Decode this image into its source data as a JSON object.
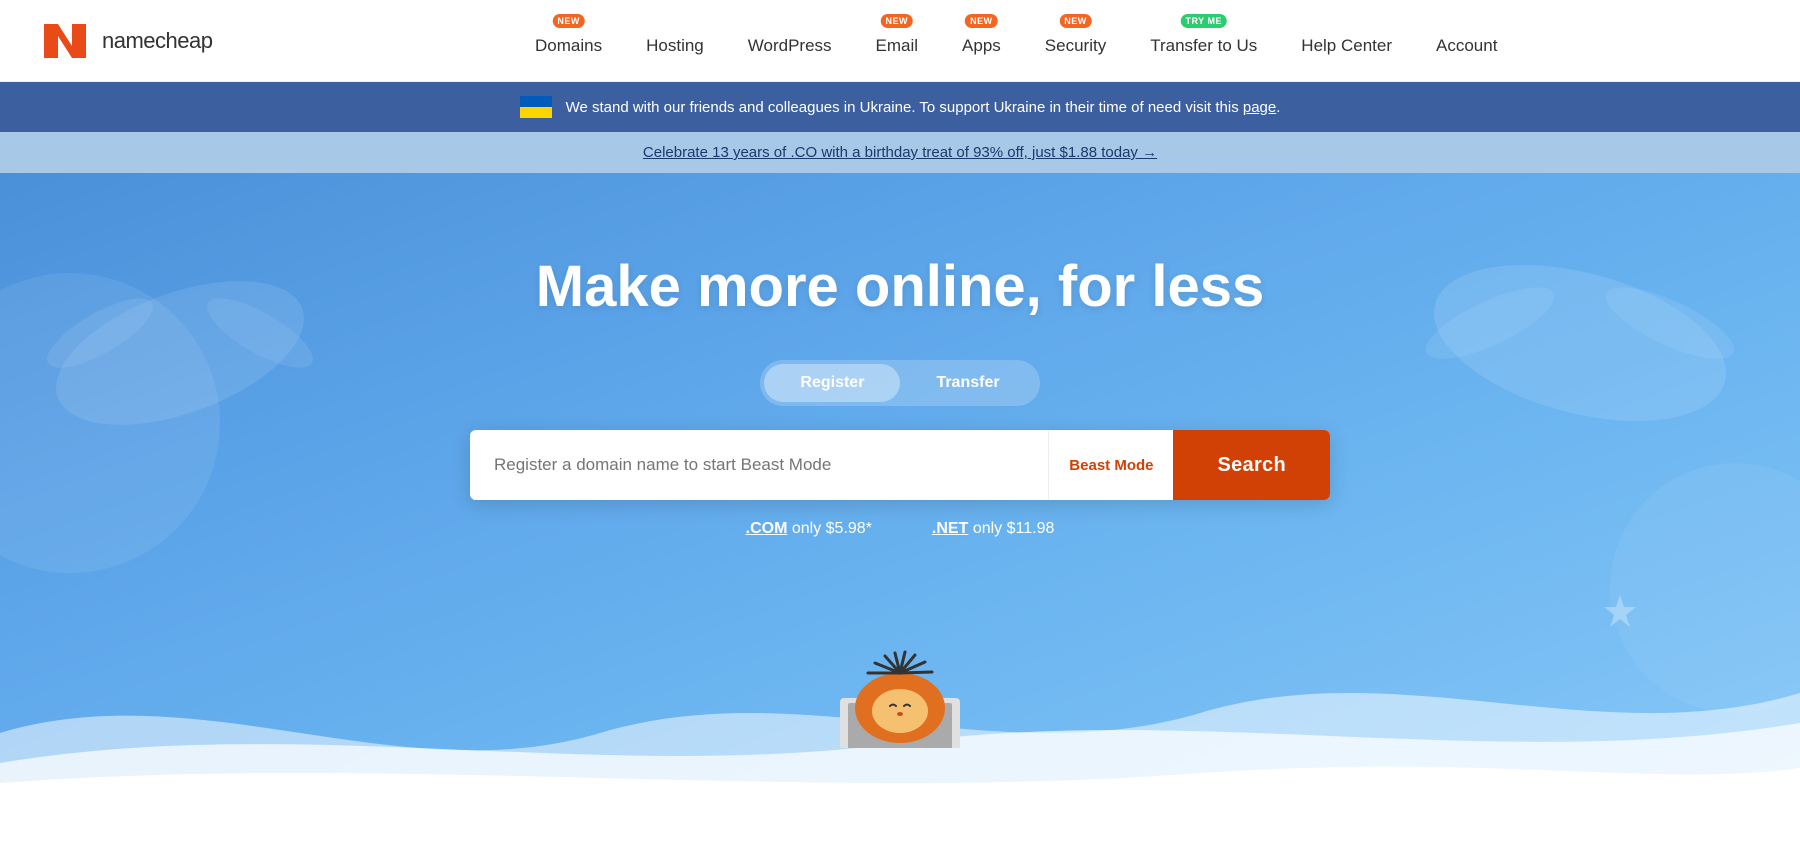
{
  "header": {
    "logo_text": "namecheap",
    "nav_items": [
      {
        "id": "domains",
        "label": "Domains",
        "badge": "NEW",
        "badge_type": "new"
      },
      {
        "id": "hosting",
        "label": "Hosting",
        "badge": null,
        "badge_type": null
      },
      {
        "id": "wordpress",
        "label": "WordPress",
        "badge": null,
        "badge_type": null
      },
      {
        "id": "email",
        "label": "Email",
        "badge": "NEW",
        "badge_type": "new"
      },
      {
        "id": "apps",
        "label": "Apps",
        "badge": "NEW",
        "badge_type": "new"
      },
      {
        "id": "security",
        "label": "Security",
        "badge": "NEW",
        "badge_type": "new"
      },
      {
        "id": "transfer",
        "label": "Transfer to Us",
        "badge": "TRY ME",
        "badge_type": "tryme"
      },
      {
        "id": "help",
        "label": "Help Center",
        "badge": null,
        "badge_type": null
      },
      {
        "id": "account",
        "label": "Account",
        "badge": null,
        "badge_type": null
      }
    ]
  },
  "ukraine_banner": {
    "text_before": "We stand with our friends and colleagues in Ukraine. To support Ukraine in their time of need visit this ",
    "link_text": "page",
    "text_after": "."
  },
  "promo_banner": {
    "link_text": "Celebrate 13 years of .CO with a birthday treat of 93% off, just $1.88 today →"
  },
  "hero": {
    "title": "Make more online, for less",
    "tab_register": "Register",
    "tab_transfer": "Transfer",
    "search_placeholder": "Register a domain name to start Beast Mode",
    "beast_mode_label": "Beast Mode",
    "search_button_label": "Search",
    "price_com": ".COM only $5.98*",
    "price_net": ".NET only $11.98"
  }
}
